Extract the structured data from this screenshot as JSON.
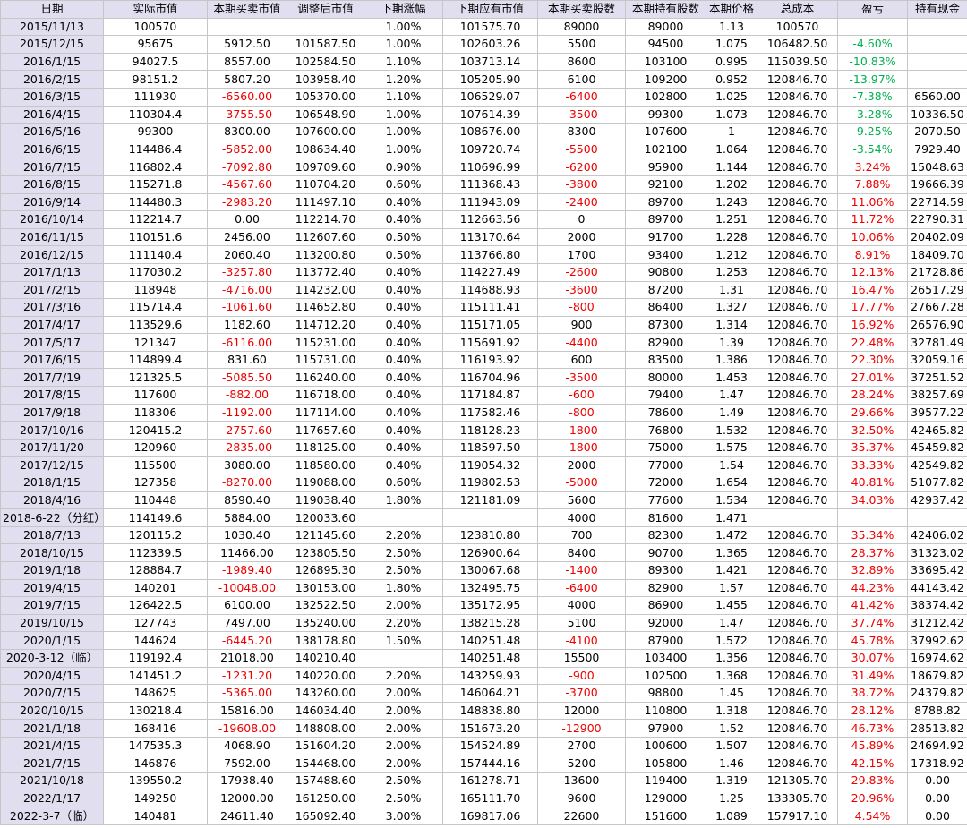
{
  "columns": [
    "日期",
    "实际市值",
    "本期买卖市值",
    "调整后市值",
    "下期涨幅",
    "下期应有市值",
    "本期买卖股数",
    "本期持有股数",
    "本期价格",
    "总成本",
    "盈亏",
    "持有现金"
  ],
  "colors": {
    "header_bg": "#e1def0",
    "date_bg": "#e1def0",
    "negative": "#ee0000",
    "positive_profit": "#00b050",
    "grid": "#c6c6c6"
  },
  "rows": [
    [
      "2015/11/13",
      "100570",
      "",
      "",
      "1.00%",
      "101575.70",
      "89000",
      "89000",
      "1.13",
      "100570",
      "",
      ""
    ],
    [
      "2015/12/15",
      "95675",
      "5912.50",
      "101587.50",
      "1.00%",
      "102603.26",
      "5500",
      "94500",
      "1.075",
      "106482.50",
      "-4.60%",
      ""
    ],
    [
      "2016/1/15",
      "94027.5",
      "8557.00",
      "102584.50",
      "1.10%",
      "103713.14",
      "8600",
      "103100",
      "0.995",
      "115039.50",
      "-10.83%",
      ""
    ],
    [
      "2016/2/15",
      "98151.2",
      "5807.20",
      "103958.40",
      "1.20%",
      "105205.90",
      "6100",
      "109200",
      "0.952",
      "120846.70",
      "-13.97%",
      ""
    ],
    [
      "2016/3/15",
      "111930",
      "-6560.00",
      "105370.00",
      "1.10%",
      "106529.07",
      "-6400",
      "102800",
      "1.025",
      "120846.70",
      "-7.38%",
      "6560.00"
    ],
    [
      "2016/4/15",
      "110304.4",
      "-3755.50",
      "106548.90",
      "1.00%",
      "107614.39",
      "-3500",
      "99300",
      "1.073",
      "120846.70",
      "-3.28%",
      "10336.50"
    ],
    [
      "2016/5/16",
      "99300",
      "8300.00",
      "107600.00",
      "1.00%",
      "108676.00",
      "8300",
      "107600",
      "1",
      "120846.70",
      "-9.25%",
      "2070.50"
    ],
    [
      "2016/6/15",
      "114486.4",
      "-5852.00",
      "108634.40",
      "1.00%",
      "109720.74",
      "-5500",
      "102100",
      "1.064",
      "120846.70",
      "-3.54%",
      "7929.40"
    ],
    [
      "2016/7/15",
      "116802.4",
      "-7092.80",
      "109709.60",
      "0.90%",
      "110696.99",
      "-6200",
      "95900",
      "1.144",
      "120846.70",
      "3.24%",
      "15048.63"
    ],
    [
      "2016/8/15",
      "115271.8",
      "-4567.60",
      "110704.20",
      "0.60%",
      "111368.43",
      "-3800",
      "92100",
      "1.202",
      "120846.70",
      "7.88%",
      "19666.39"
    ],
    [
      "2016/9/14",
      "114480.3",
      "-2983.20",
      "111497.10",
      "0.40%",
      "111943.09",
      "-2400",
      "89700",
      "1.243",
      "120846.70",
      "11.06%",
      "22714.59"
    ],
    [
      "2016/10/14",
      "112214.7",
      "0.00",
      "112214.70",
      "0.40%",
      "112663.56",
      "0",
      "89700",
      "1.251",
      "120846.70",
      "11.72%",
      "22790.31"
    ],
    [
      "2016/11/15",
      "110151.6",
      "2456.00",
      "112607.60",
      "0.50%",
      "113170.64",
      "2000",
      "91700",
      "1.228",
      "120846.70",
      "10.06%",
      "20402.09"
    ],
    [
      "2016/12/15",
      "111140.4",
      "2060.40",
      "113200.80",
      "0.50%",
      "113766.80",
      "1700",
      "93400",
      "1.212",
      "120846.70",
      "8.91%",
      "18409.70"
    ],
    [
      "2017/1/13",
      "117030.2",
      "-3257.80",
      "113772.40",
      "0.40%",
      "114227.49",
      "-2600",
      "90800",
      "1.253",
      "120846.70",
      "12.13%",
      "21728.86"
    ],
    [
      "2017/2/15",
      "118948",
      "-4716.00",
      "114232.00",
      "0.40%",
      "114688.93",
      "-3600",
      "87200",
      "1.31",
      "120846.70",
      "16.47%",
      "26517.29"
    ],
    [
      "2017/3/16",
      "115714.4",
      "-1061.60",
      "114652.80",
      "0.40%",
      "115111.41",
      "-800",
      "86400",
      "1.327",
      "120846.70",
      "17.77%",
      "27667.28"
    ],
    [
      "2017/4/17",
      "113529.6",
      "1182.60",
      "114712.20",
      "0.40%",
      "115171.05",
      "900",
      "87300",
      "1.314",
      "120846.70",
      "16.92%",
      "26576.90"
    ],
    [
      "2017/5/17",
      "121347",
      "-6116.00",
      "115231.00",
      "0.40%",
      "115691.92",
      "-4400",
      "82900",
      "1.39",
      "120846.70",
      "22.48%",
      "32781.49"
    ],
    [
      "2017/6/15",
      "114899.4",
      "831.60",
      "115731.00",
      "0.40%",
      "116193.92",
      "600",
      "83500",
      "1.386",
      "120846.70",
      "22.30%",
      "32059.16"
    ],
    [
      "2017/7/19",
      "121325.5",
      "-5085.50",
      "116240.00",
      "0.40%",
      "116704.96",
      "-3500",
      "80000",
      "1.453",
      "120846.70",
      "27.01%",
      "37251.52"
    ],
    [
      "2017/8/15",
      "117600",
      "-882.00",
      "116718.00",
      "0.40%",
      "117184.87",
      "-600",
      "79400",
      "1.47",
      "120846.70",
      "28.24%",
      "38257.69"
    ],
    [
      "2017/9/18",
      "118306",
      "-1192.00",
      "117114.00",
      "0.40%",
      "117582.46",
      "-800",
      "78600",
      "1.49",
      "120846.70",
      "29.66%",
      "39577.22"
    ],
    [
      "2017/10/16",
      "120415.2",
      "-2757.60",
      "117657.60",
      "0.40%",
      "118128.23",
      "-1800",
      "76800",
      "1.532",
      "120846.70",
      "32.50%",
      "42465.82"
    ],
    [
      "2017/11/20",
      "120960",
      "-2835.00",
      "118125.00",
      "0.40%",
      "118597.50",
      "-1800",
      "75000",
      "1.575",
      "120846.70",
      "35.37%",
      "45459.82"
    ],
    [
      "2017/12/15",
      "115500",
      "3080.00",
      "118580.00",
      "0.40%",
      "119054.32",
      "2000",
      "77000",
      "1.54",
      "120846.70",
      "33.33%",
      "42549.82"
    ],
    [
      "2018/1/15",
      "127358",
      "-8270.00",
      "119088.00",
      "0.60%",
      "119802.53",
      "-5000",
      "72000",
      "1.654",
      "120846.70",
      "40.81%",
      "51077.82"
    ],
    [
      "2018/4/16",
      "110448",
      "8590.40",
      "119038.40",
      "1.80%",
      "121181.09",
      "5600",
      "77600",
      "1.534",
      "120846.70",
      "34.03%",
      "42937.42"
    ],
    [
      "2018-6-22（分红）",
      "114149.6",
      "5884.00",
      "120033.60",
      "",
      "",
      "4000",
      "81600",
      "1.471",
      "",
      "",
      ""
    ],
    [
      "2018/7/13",
      "120115.2",
      "1030.40",
      "121145.60",
      "2.20%",
      "123810.80",
      "700",
      "82300",
      "1.472",
      "120846.70",
      "35.34%",
      "42406.02"
    ],
    [
      "2018/10/15",
      "112339.5",
      "11466.00",
      "123805.50",
      "2.50%",
      "126900.64",
      "8400",
      "90700",
      "1.365",
      "120846.70",
      "28.37%",
      "31323.02"
    ],
    [
      "2019/1/18",
      "128884.7",
      "-1989.40",
      "126895.30",
      "2.50%",
      "130067.68",
      "-1400",
      "89300",
      "1.421",
      "120846.70",
      "32.89%",
      "33695.42"
    ],
    [
      "2019/4/15",
      "140201",
      "-10048.00",
      "130153.00",
      "1.80%",
      "132495.75",
      "-6400",
      "82900",
      "1.57",
      "120846.70",
      "44.23%",
      "44143.42"
    ],
    [
      "2019/7/15",
      "126422.5",
      "6100.00",
      "132522.50",
      "2.00%",
      "135172.95",
      "4000",
      "86900",
      "1.455",
      "120846.70",
      "41.42%",
      "38374.42"
    ],
    [
      "2019/10/15",
      "127743",
      "7497.00",
      "135240.00",
      "2.20%",
      "138215.28",
      "5100",
      "92000",
      "1.47",
      "120846.70",
      "37.74%",
      "31212.42"
    ],
    [
      "2020/1/15",
      "144624",
      "-6445.20",
      "138178.80",
      "1.50%",
      "140251.48",
      "-4100",
      "87900",
      "1.572",
      "120846.70",
      "45.78%",
      "37992.62"
    ],
    [
      "2020-3-12（临）",
      "119192.4",
      "21018.00",
      "140210.40",
      "",
      "140251.48",
      "15500",
      "103400",
      "1.356",
      "120846.70",
      "30.07%",
      "16974.62"
    ],
    [
      "2020/4/15",
      "141451.2",
      "-1231.20",
      "140220.00",
      "2.20%",
      "143259.93",
      "-900",
      "102500",
      "1.368",
      "120846.70",
      "31.49%",
      "18679.82"
    ],
    [
      "2020/7/15",
      "148625",
      "-5365.00",
      "143260.00",
      "2.00%",
      "146064.21",
      "-3700",
      "98800",
      "1.45",
      "120846.70",
      "38.72%",
      "24379.82"
    ],
    [
      "2020/10/15",
      "130218.4",
      "15816.00",
      "146034.40",
      "2.00%",
      "148838.80",
      "12000",
      "110800",
      "1.318",
      "120846.70",
      "28.12%",
      "8788.82"
    ],
    [
      "2021/1/18",
      "168416",
      "-19608.00",
      "148808.00",
      "2.00%",
      "151673.20",
      "-12900",
      "97900",
      "1.52",
      "120846.70",
      "46.73%",
      "28513.82"
    ],
    [
      "2021/4/15",
      "147535.3",
      "4068.90",
      "151604.20",
      "2.00%",
      "154524.89",
      "2700",
      "100600",
      "1.507",
      "120846.70",
      "45.89%",
      "24694.92"
    ],
    [
      "2021/7/15",
      "146876",
      "7592.00",
      "154468.00",
      "2.00%",
      "157444.16",
      "5200",
      "105800",
      "1.46",
      "120846.70",
      "42.15%",
      "17318.92"
    ],
    [
      "2021/10/18",
      "139550.2",
      "17938.40",
      "157488.60",
      "2.50%",
      "161278.71",
      "13600",
      "119400",
      "1.319",
      "121305.70",
      "29.83%",
      "0.00"
    ],
    [
      "2022/1/17",
      "149250",
      "12000.00",
      "161250.00",
      "2.50%",
      "165111.70",
      "9600",
      "129000",
      "1.25",
      "133305.70",
      "20.96%",
      "0.00"
    ],
    [
      "2022-3-7（临）",
      "140481",
      "24611.40",
      "165092.40",
      "3.00%",
      "169817.06",
      "22600",
      "151600",
      "1.089",
      "157917.10",
      "4.54%",
      "0.00"
    ]
  ]
}
